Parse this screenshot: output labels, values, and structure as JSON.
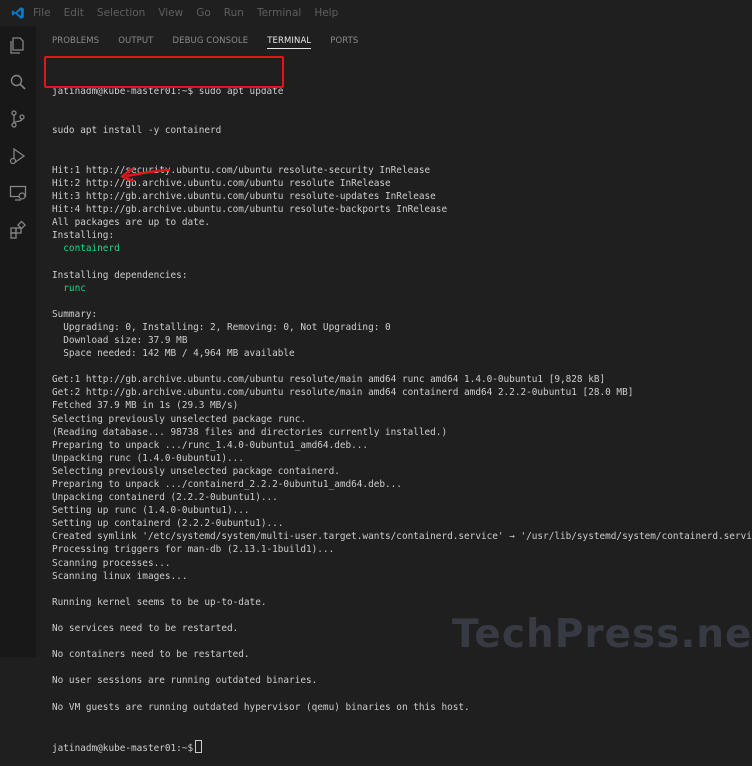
{
  "menu": [
    "File",
    "Edit",
    "Selection",
    "View",
    "Go",
    "Run",
    "Terminal",
    "Help"
  ],
  "tabs": [
    "PROBLEMS",
    "OUTPUT",
    "DEBUG CONSOLE",
    "TERMINAL",
    "PORTS"
  ],
  "active_tab": "TERMINAL",
  "terminal": {
    "prompt": "jatinadm@kube-master01:~$",
    "command1": " sudo apt update",
    "command2": "sudo apt install -y containerd",
    "lines": [
      "Hit:1 http://security.ubuntu.com/ubuntu resolute-security InRelease",
      "Hit:2 http://gb.archive.ubuntu.com/ubuntu resolute InRelease",
      "Hit:3 http://gb.archive.ubuntu.com/ubuntu resolute-updates InRelease",
      "Hit:4 http://gb.archive.ubuntu.com/ubuntu resolute-backports InRelease",
      "All packages are up to date.",
      "Installing:",
      "  containerd",
      "",
      "Installing dependencies:",
      "  runc",
      "",
      "Summary:",
      "  Upgrading: 0, Installing: 2, Removing: 0, Not Upgrading: 0",
      "  Download size: 37.9 MB",
      "  Space needed: 142 MB / 4,964 MB available",
      "",
      "Get:1 http://gb.archive.ubuntu.com/ubuntu resolute/main amd64 runc amd64 1.4.0-0ubuntu1 [9,828 kB]",
      "Get:2 http://gb.archive.ubuntu.com/ubuntu resolute/main amd64 containerd amd64 2.2.2-0ubuntu1 [28.0 MB]",
      "Fetched 37.9 MB in 1s (29.3 MB/s)",
      "Selecting previously unselected package runc.",
      "(Reading database... 98738 files and directories currently installed.)",
      "Preparing to unpack .../runc_1.4.0-0ubuntu1_amd64.deb...",
      "Unpacking runc (1.4.0-0ubuntu1)...",
      "Selecting previously unselected package containerd.",
      "Preparing to unpack .../containerd_2.2.2-0ubuntu1_amd64.deb...",
      "Unpacking containerd (2.2.2-0ubuntu1)...",
      "Setting up runc (1.4.0-0ubuntu1)...",
      "Setting up containerd (2.2.2-0ubuntu1)...",
      "Created symlink '/etc/systemd/system/multi-user.target.wants/containerd.service' → '/usr/lib/systemd/system/containerd.service'.",
      "Processing triggers for man-db (2.13.1-1build1)...",
      "Scanning processes...",
      "Scanning linux images...",
      "",
      "Running kernel seems to be up-to-date.",
      "",
      "No services need to be restarted.",
      "",
      "No containers need to be restarted.",
      "",
      "No user sessions are running outdated binaries.",
      "",
      "No VM guests are running outdated hypervisor (qemu) binaries on this host."
    ],
    "green_lines": [
      6,
      9
    ],
    "final_prompt": "jatinadm@kube-master01:~$"
  },
  "watermark": "TechPress.net",
  "colors": {
    "accent": "#0078d4",
    "highlight": "#e4141b",
    "green": "#23d18b"
  }
}
